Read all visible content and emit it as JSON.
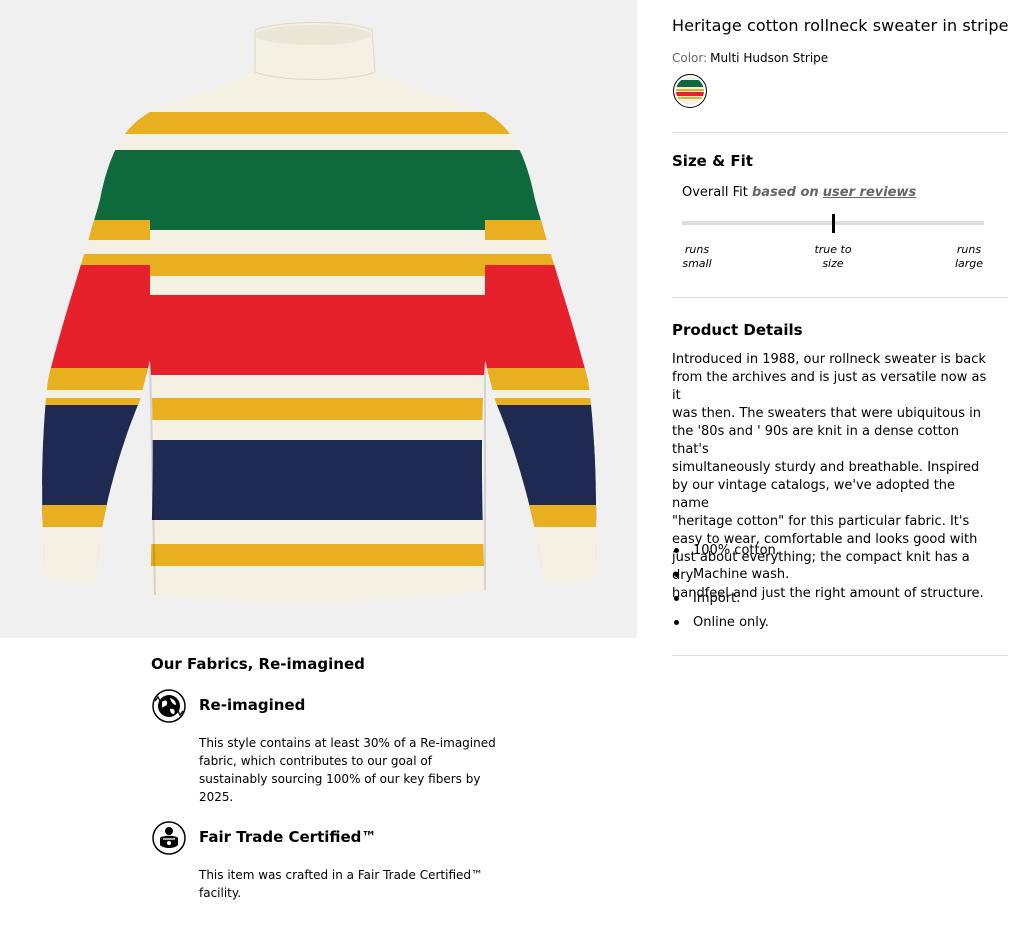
{
  "product": {
    "title": "Heritage cotton rollneck sweater in stripe",
    "color_label": "Color:",
    "color_value": "Multi Hudson Stripe",
    "image_icon": "striped-rollneck-sweater-image",
    "swatch_icon": "multi-hudson-stripe-swatch"
  },
  "size_fit": {
    "heading": "Size & Fit",
    "overall_fit_label": "Overall Fit",
    "based_on_label": "based on",
    "reviews_link": "user reviews",
    "fit_value": 0.5,
    "scale_labels": [
      {
        "line1": "runs",
        "line2": "small"
      },
      {
        "line1": "true to",
        "line2": "size"
      },
      {
        "line1": "runs",
        "line2": "large"
      }
    ]
  },
  "product_details": {
    "heading": "Product Details",
    "description_lines": [
      "Introduced in 1988, our rollneck sweater is back",
      "from the archives and is just as versatile now as it",
      "was then. The sweaters that were ubiquitous in",
      "the '80s and ' 90s are knit in a dense cotton that's",
      "simultaneously sturdy and breathable. Inspired",
      "by our vintage catalogs, we've adopted the name",
      "\"heritage cotton\" for this particular fabric. It's",
      "easy to wear, comfortable and looks good with",
      "just about everything; the compact knit has a dry",
      "handfeel and just the right amount of structure."
    ],
    "bullets": [
      "100% cotton.",
      "Machine wash.",
      "Import.",
      "Online only."
    ]
  },
  "fabrics": {
    "heading": "Our Fabrics, Re-imagined",
    "items": [
      {
        "icon": "globe-recycle-icon",
        "title": "Re-imagined",
        "lines": [
          "This style contains at least 30% of a Re-imagined",
          "fabric, which contributes to our goal of",
          "sustainably sourcing 100% of our key fibers by",
          "2025."
        ]
      },
      {
        "icon": "fair-trade-icon",
        "title": "Fair Trade Certified™",
        "lines": [
          "This item was crafted in a Fair Trade Certified™",
          "facility."
        ]
      }
    ]
  },
  "colors": {
    "image_bg": "#f0f0f0",
    "cream": "#f5f0e4",
    "green": "#0e6a3c",
    "yellow": "#e8b020",
    "red": "#e6212b",
    "navy": "#1f2a52",
    "divider": "#dddddd",
    "muted_text": "#666666"
  }
}
